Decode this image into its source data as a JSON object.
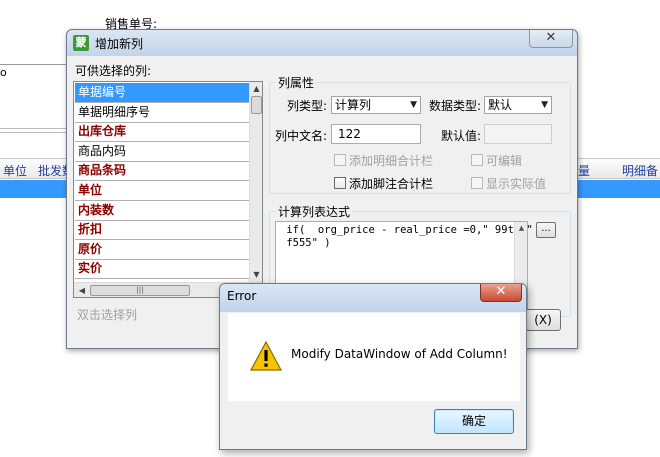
{
  "background": {
    "sales_no_label": "销售单号:",
    "letter": "o",
    "columns": {
      "unit": "单位",
      "wholesale": "批发数",
      "right": "量",
      "detail": "明细备注"
    }
  },
  "add_column_dialog": {
    "title": "增加新列",
    "app_icon": "蒙",
    "close_label": "✕",
    "available_label": "可供选择的列:",
    "list_items": [
      {
        "label": "单据编号",
        "selected": true,
        "red": false
      },
      {
        "label": "单据明细序号",
        "selected": false,
        "red": false
      },
      {
        "label": "出库仓库",
        "selected": false,
        "red": true
      },
      {
        "label": "商品内码",
        "selected": false,
        "red": false
      },
      {
        "label": "商品条码",
        "selected": false,
        "red": true
      },
      {
        "label": "单位",
        "selected": false,
        "red": true
      },
      {
        "label": "内装数",
        "selected": false,
        "red": true
      },
      {
        "label": "折扣",
        "selected": false,
        "red": true
      },
      {
        "label": "原价",
        "selected": false,
        "red": true
      },
      {
        "label": "实价",
        "selected": false,
        "red": true
      }
    ],
    "double_click_hint": "双击选择列",
    "properties": {
      "title": "列属性",
      "column_type_label": "列类型:",
      "column_type_value": "计算列",
      "data_type_label": "数据类型:",
      "data_type_value": "默认",
      "chinese_name_label": "列中文名:",
      "chinese_name_value": "122",
      "default_value_label": "默认值:",
      "default_value_value": "",
      "add_detail_total": "添加明细合计栏",
      "editable": "可编辑",
      "add_footer_total": "添加脚注合计栏",
      "show_actual": "显示实际值"
    },
    "expression": {
      "title": "计算列表达式",
      "text": " if(  org_price - real_price =0,\" 99t\",\"\n f555\" )",
      "ellipsis_label": "...",
      "cancel_partial": "(X)"
    }
  },
  "error_dialog": {
    "title": "Error",
    "close_label": "✕",
    "message": "Modify DataWindow of Add Column!",
    "ok_label": "确定"
  },
  "icons": {
    "dropdown": "▼",
    "scroll_up": "▲",
    "scroll_down": "▼",
    "scroll_left": "◀",
    "scroll_right": "▶",
    "grip": "|||"
  },
  "colors": {
    "selection": "#3399ff",
    "red_field": "#8b0000",
    "header_text": "#1f3f9f"
  }
}
